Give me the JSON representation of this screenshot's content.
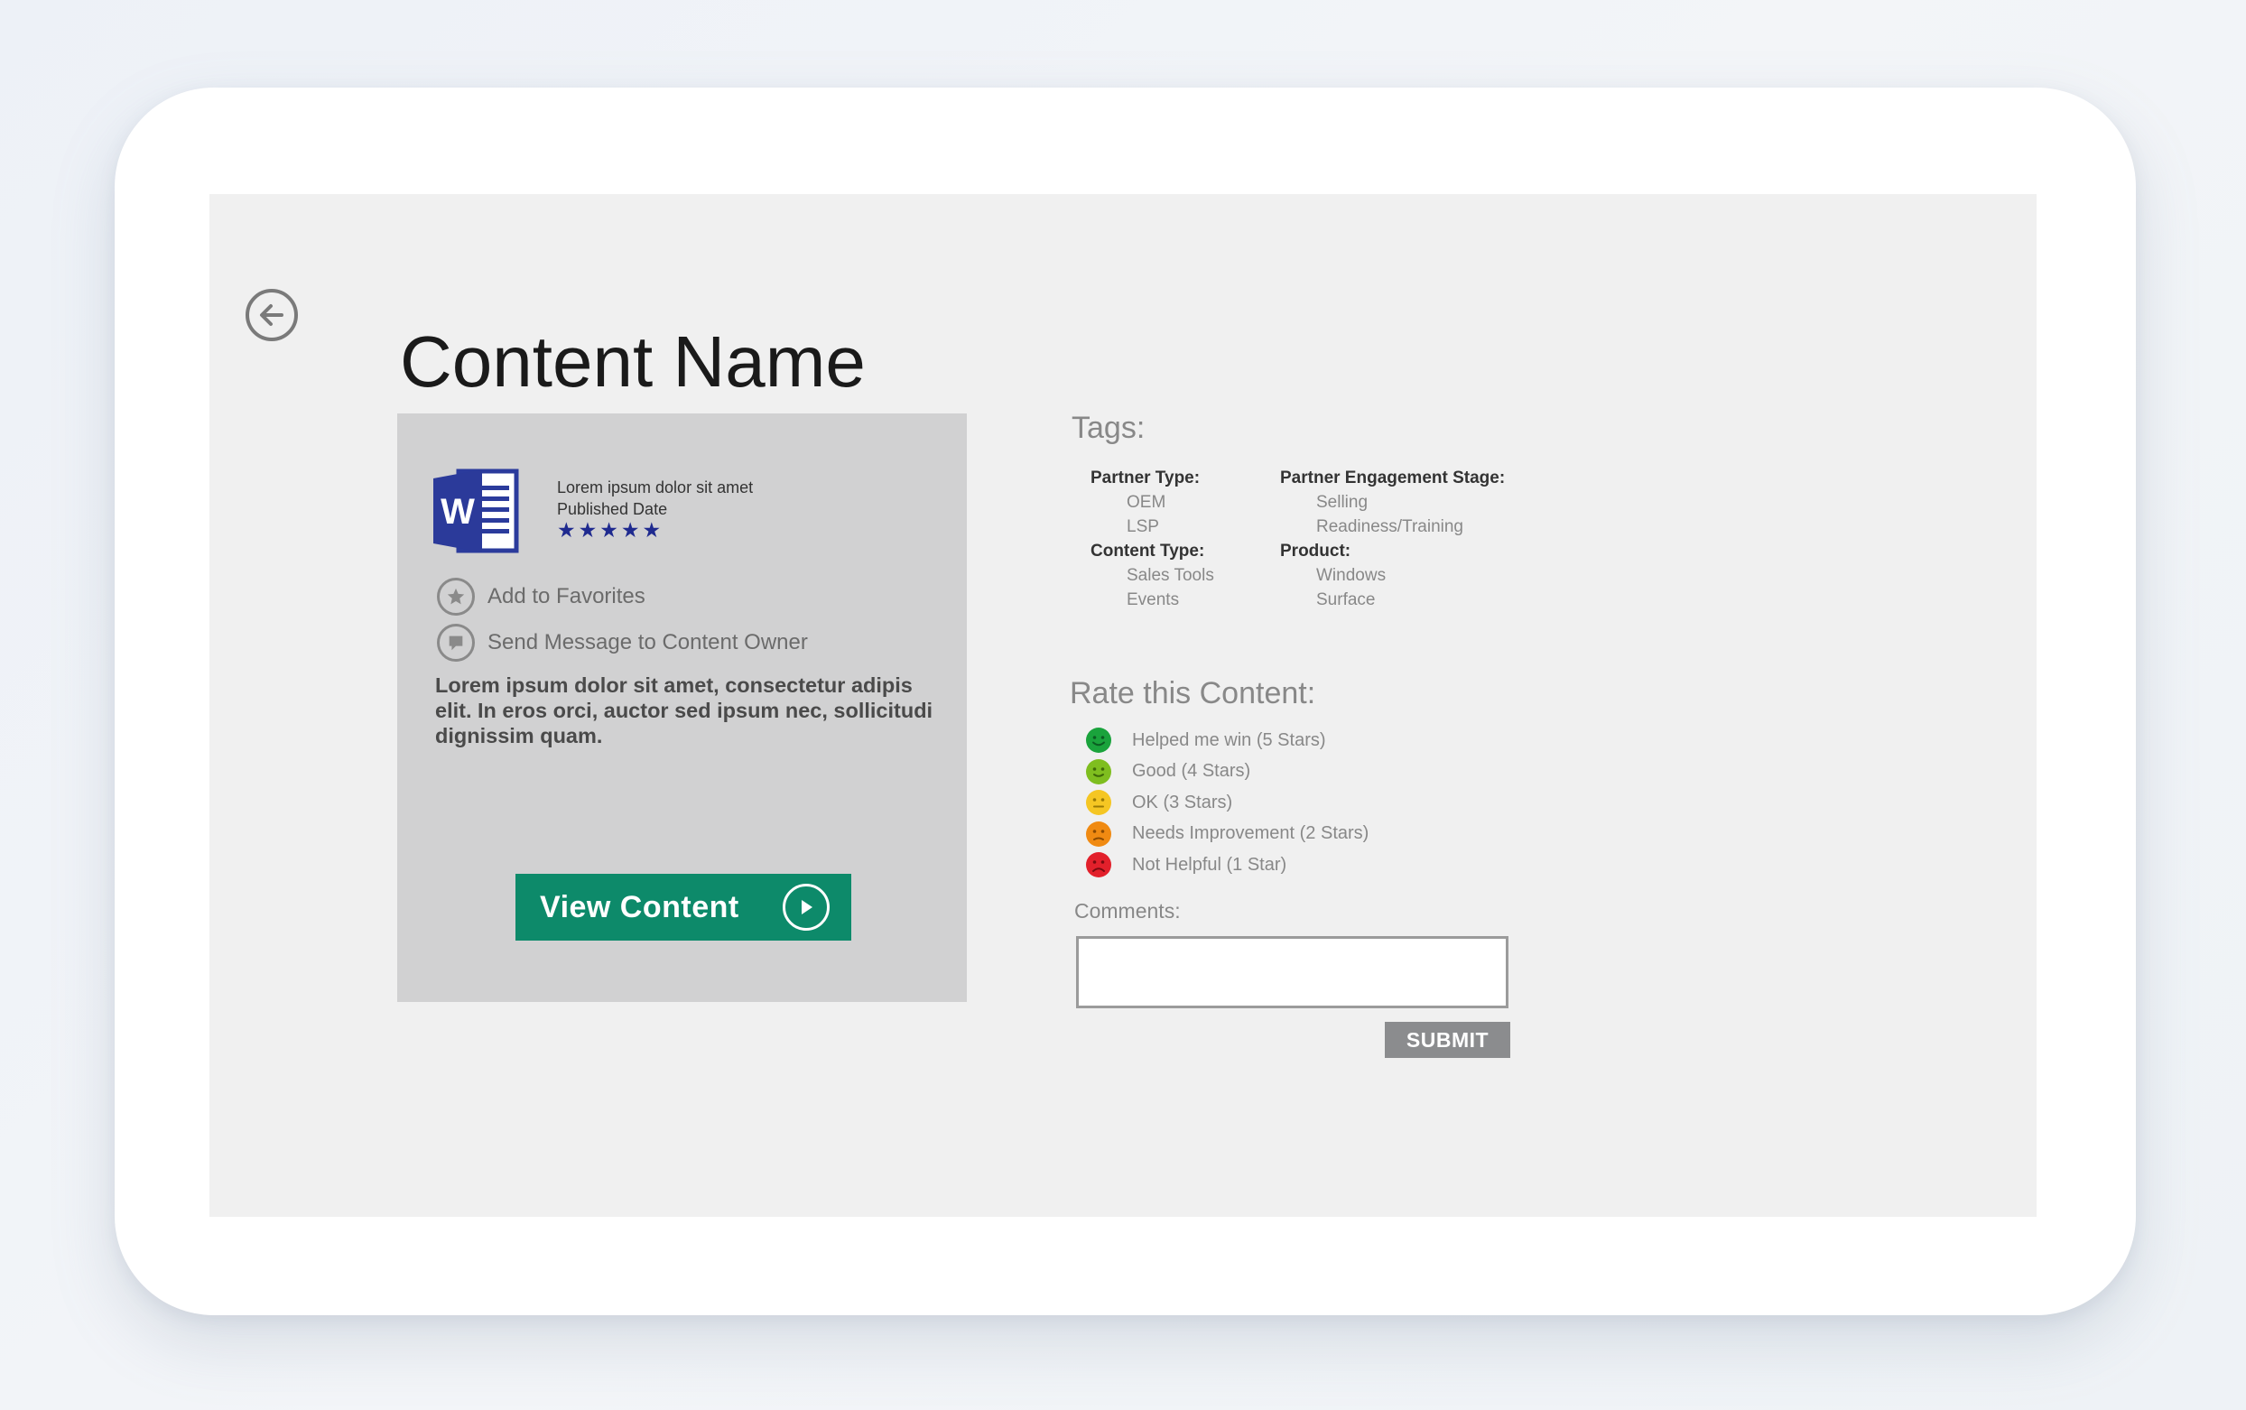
{
  "page": {
    "title": "Content Name",
    "accent_color": "#0d8a6a",
    "background_color": "#f0f0f0"
  },
  "card": {
    "doc_icon": "word-document-icon",
    "doc_title": "Lorem ipsum dolor sit amet",
    "published_label": "Published Date",
    "rating_stars": 5,
    "star_color": "#1f2a8f",
    "actions": [
      {
        "label": "Add to Favorites",
        "icon": "star-icon"
      },
      {
        "label": "Send Message to Content Owner",
        "icon": "message-icon"
      }
    ],
    "description": "Lorem ipsum dolor sit amet, consectetur adipis elit. In eros orci, auctor sed ipsum nec, sollicitudi dignissim quam.",
    "view_button": {
      "label": "View Content",
      "icon": "play-circle-icon"
    }
  },
  "tags": {
    "heading": "Tags:",
    "partner_type": {
      "label": "Partner Type:",
      "values": [
        "OEM",
        "LSP"
      ]
    },
    "content_type": {
      "label": "Content Type:",
      "values": [
        "Sales Tools",
        "Events"
      ]
    },
    "partner_engagement_stage": {
      "label": "Partner Engagement Stage:",
      "values": [
        "Selling",
        "Readiness/Training"
      ]
    },
    "product": {
      "label": "Product:",
      "values": [
        "Windows",
        "Surface"
      ]
    }
  },
  "rate": {
    "heading": "Rate this Content:",
    "options": [
      {
        "label": "Helped me win (5 Stars)",
        "color": "#1aa33c"
      },
      {
        "label": "Good (4 Stars)",
        "color": "#7fbe1f"
      },
      {
        "label": "OK (3 Stars)",
        "color": "#f5c623"
      },
      {
        "label": "Needs Improvement (2 Stars)",
        "color": "#f08a12"
      },
      {
        "label": "Not Helpful (1 Star)",
        "color": "#e2202b"
      }
    ],
    "comments_label": "Comments:",
    "comments_value": "",
    "submit_label": "SUBMIT"
  }
}
